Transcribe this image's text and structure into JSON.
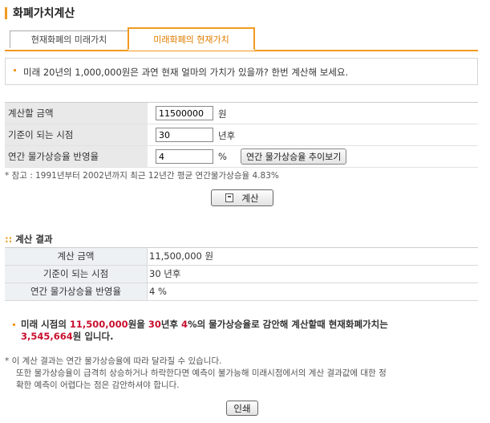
{
  "page": {
    "title": "화폐가치계산"
  },
  "tabs": [
    {
      "label": "현재화폐의 미래가치",
      "active": false
    },
    {
      "label": "미래화폐의 현재가치",
      "active": true
    }
  ],
  "intro": "미래 20년의 1,000,000원은 과연 현재 얼마의 가치가 있을까? 한번 계산해 보세요.",
  "form": {
    "amount": {
      "label": "계산할 금액",
      "value": "11500000",
      "unit": "원"
    },
    "period": {
      "label": "기준이 되는 시점",
      "value": "30",
      "unit": "년후"
    },
    "inflation": {
      "label": "연간 물가상승율 반영율",
      "value": "4",
      "unit": "%",
      "trend_button": "연간 물가상승율 추이보기"
    },
    "reference_note": "* 참고 : 1991년부터 2002년까지 최근 12년간 평균 연간물가상승율 4.83%",
    "calc_button": "계산"
  },
  "result": {
    "title_prefix": "::",
    "title": "계산 결과",
    "rows": [
      {
        "label": "계산 금액",
        "value": "11,500,000 원"
      },
      {
        "label": "기준이 되는 시점",
        "value": "30 년후"
      },
      {
        "label": "연간 물가상승율 반영율",
        "value": "4 %"
      }
    ]
  },
  "summary": {
    "p1": "미래 시점의 ",
    "amount": "11,500,000",
    "p2": "원을 ",
    "years": "30",
    "p3": "년후 ",
    "rate": "4",
    "p4": "%의 물가상승율로 감안해 계산할때 현재화폐가치는",
    "present_value": "3,545,664",
    "p5": "원 입니다."
  },
  "notes": [
    "* 이 계산 결과는 연간 물가상승율에 따라 달라질 수 있습니다.",
    "또한 물가상승율이 급격히 상승하거나 하락한다면 예측이 불가능해 미래시점에서의 계산 결과값에 대한 정",
    "확한 예측이 어렵다는 점은 감안하셔야 합니다."
  ],
  "print_button": "인쇄",
  "colors": {
    "accent": "#f29a1f",
    "highlight": "#c8102e"
  }
}
